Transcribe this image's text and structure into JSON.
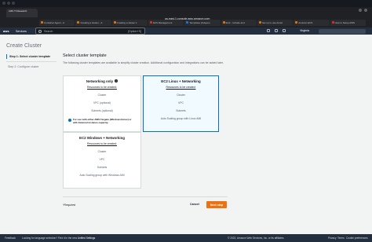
{
  "browser": {
    "active_tab": "LMS TI Research",
    "tabs": [
      "Container Agent - A",
      "Creating a cluster - A",
      "Creating a cluster 1",
      "EKS Management",
      "Templates (Indepen",
      "EC2 - Include and",
      "Set up to use Amaz",
      "Amazon ECS",
      "How to Setup AWS"
    ],
    "url": "us-east-1.console.aws.amazon.com"
  },
  "aws_nav": {
    "logo": "aws",
    "services": "Services",
    "search_placeholder": "Search",
    "search_hint": "[Option+S]",
    "region": "Virginia"
  },
  "page": {
    "title": "Create Cluster",
    "steps": [
      "Step 1: Select cluster template",
      "Step 2: Configure cluster"
    ],
    "section_title": "Select cluster template",
    "section_desc": "The following cluster templates are available to simplify cluster creation. Additional configuration and integrations can be added later.",
    "templates": [
      {
        "title": "Networking only",
        "resources_label": "Resources to be created:",
        "resources": [
          "Cluster",
          "VPC (optional)",
          "Subnets (optional)"
        ],
        "note": "For use with either AWS Fargate (Windows/Linux) or with External instance capacity."
      },
      {
        "title": "EC2 Linux + Networking",
        "resources_label": "Resources to be created:",
        "resources": [
          "Cluster",
          "VPC",
          "Subnets",
          "Auto Scaling group with Linux AMI"
        ]
      },
      {
        "title": "EC2 Windows + Networking",
        "resources_label": "Resources to be created:",
        "resources": [
          "Cluster",
          "VPC",
          "Subnets",
          "Auto Scaling group with Windows AMI"
        ]
      }
    ],
    "required": "*Required",
    "cancel": "Cancel",
    "next": "Next step"
  },
  "footer": {
    "feedback": "Feedback",
    "lang_msg": "Looking for language selection? Find it in the new",
    "lang_link": "Unified Settings",
    "copyright": "© 2022, Amazon Web Services, Inc. or its affiliates.",
    "privacy": "Privacy",
    "terms": "Terms",
    "cookies": "Cookie preferences"
  },
  "colors": {
    "accent": "#ec7211",
    "selected_border": "#0073bb",
    "nav_bg": "#232f3e"
  }
}
